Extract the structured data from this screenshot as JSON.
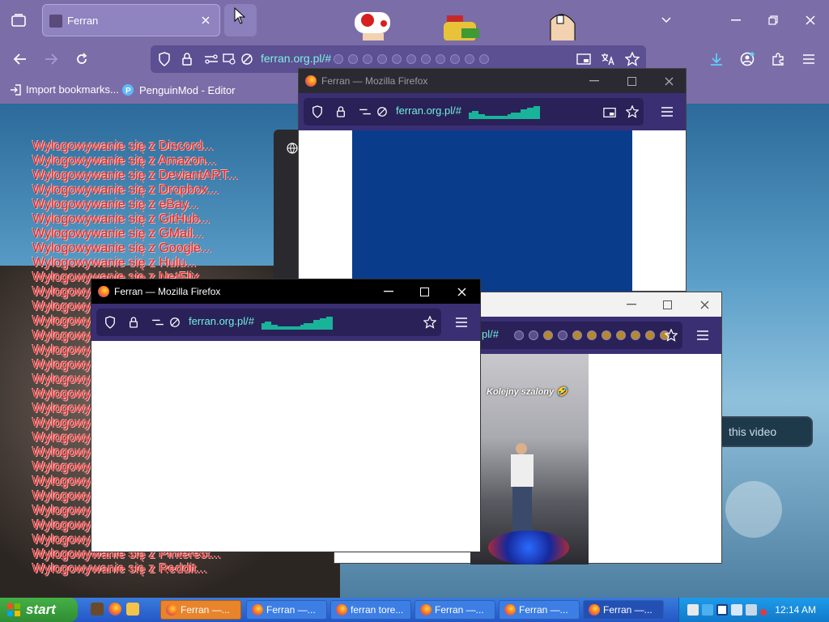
{
  "browser": {
    "tab": {
      "title": "Ferran"
    },
    "url": "ferran.org.pl/#",
    "bookmarks": [
      {
        "label": "Import bookmarks...",
        "icon": "import-icon"
      },
      {
        "label": "PenguinMod - Editor",
        "icon": "penguinmod-icon"
      }
    ]
  },
  "page": {
    "logout_lines": [
      "Wylogowywanie się z Discord...",
      "Wylogowywanie się z Amazon...",
      "Wylogowywanie się z DeviantART...",
      "Wylogowywanie się z Dropbox...",
      "Wylogowywanie się z eBay...",
      "Wylogowywanie się z GitHub...",
      "Wylogowywanie się z GMail...",
      "Wylogowywanie się z Google...",
      "Wylogowywanie się z Hulu...",
      "Wylogowywanie się z NetFlix...",
      "Wylogowy",
      "Wylogowy",
      "Wylogowy",
      "Wylogowy",
      "Wylogowy",
      "Wylogowy",
      "Wylogowy",
      "Wylogowy",
      "Wylogowy",
      "Wylogowy",
      "Wylogowy",
      "Wylogowy",
      "Wylogowy",
      "Wylogowy",
      "Wylogowy",
      "Wylogowy",
      "Wylogowywanie się z Guilded...",
      "Wylogowywanie się z LinkedIn...",
      "Wylogowywanie się z Pinterest...",
      "Wylogowywanie się z Reddit..."
    ],
    "video_pill": "this video"
  },
  "windows": {
    "win1": {
      "title": "Ferran — Mozilla Firefox",
      "url": "ferran.org.pl/#"
    },
    "win2": {
      "title": "Ferran — Mozilla Firefox",
      "url": "ferran.org.pl/#"
    },
    "win3": {
      "url": "pl/#"
    }
  },
  "video": {
    "caption": "Kolejny szalony 🤣"
  },
  "taskbar": {
    "start": "start",
    "buttons": [
      {
        "label": "Ferran —...",
        "state": "active"
      },
      {
        "label": "Ferran —...",
        "state": "normal"
      },
      {
        "label": "ferran tore...",
        "state": "normal"
      },
      {
        "label": "Ferran —...",
        "state": "normal"
      },
      {
        "label": "Ferran —...",
        "state": "normal"
      },
      {
        "label": "Ferran —...",
        "state": "pressed"
      }
    ],
    "clock": "12:14 AM"
  },
  "colors": {
    "chrome": "#7b6ea8",
    "url_text": "#7ff0e3",
    "logout_text": "#d52b2b",
    "popup_nav": "#3b2f74",
    "win1_body": "#0a3c8c"
  }
}
